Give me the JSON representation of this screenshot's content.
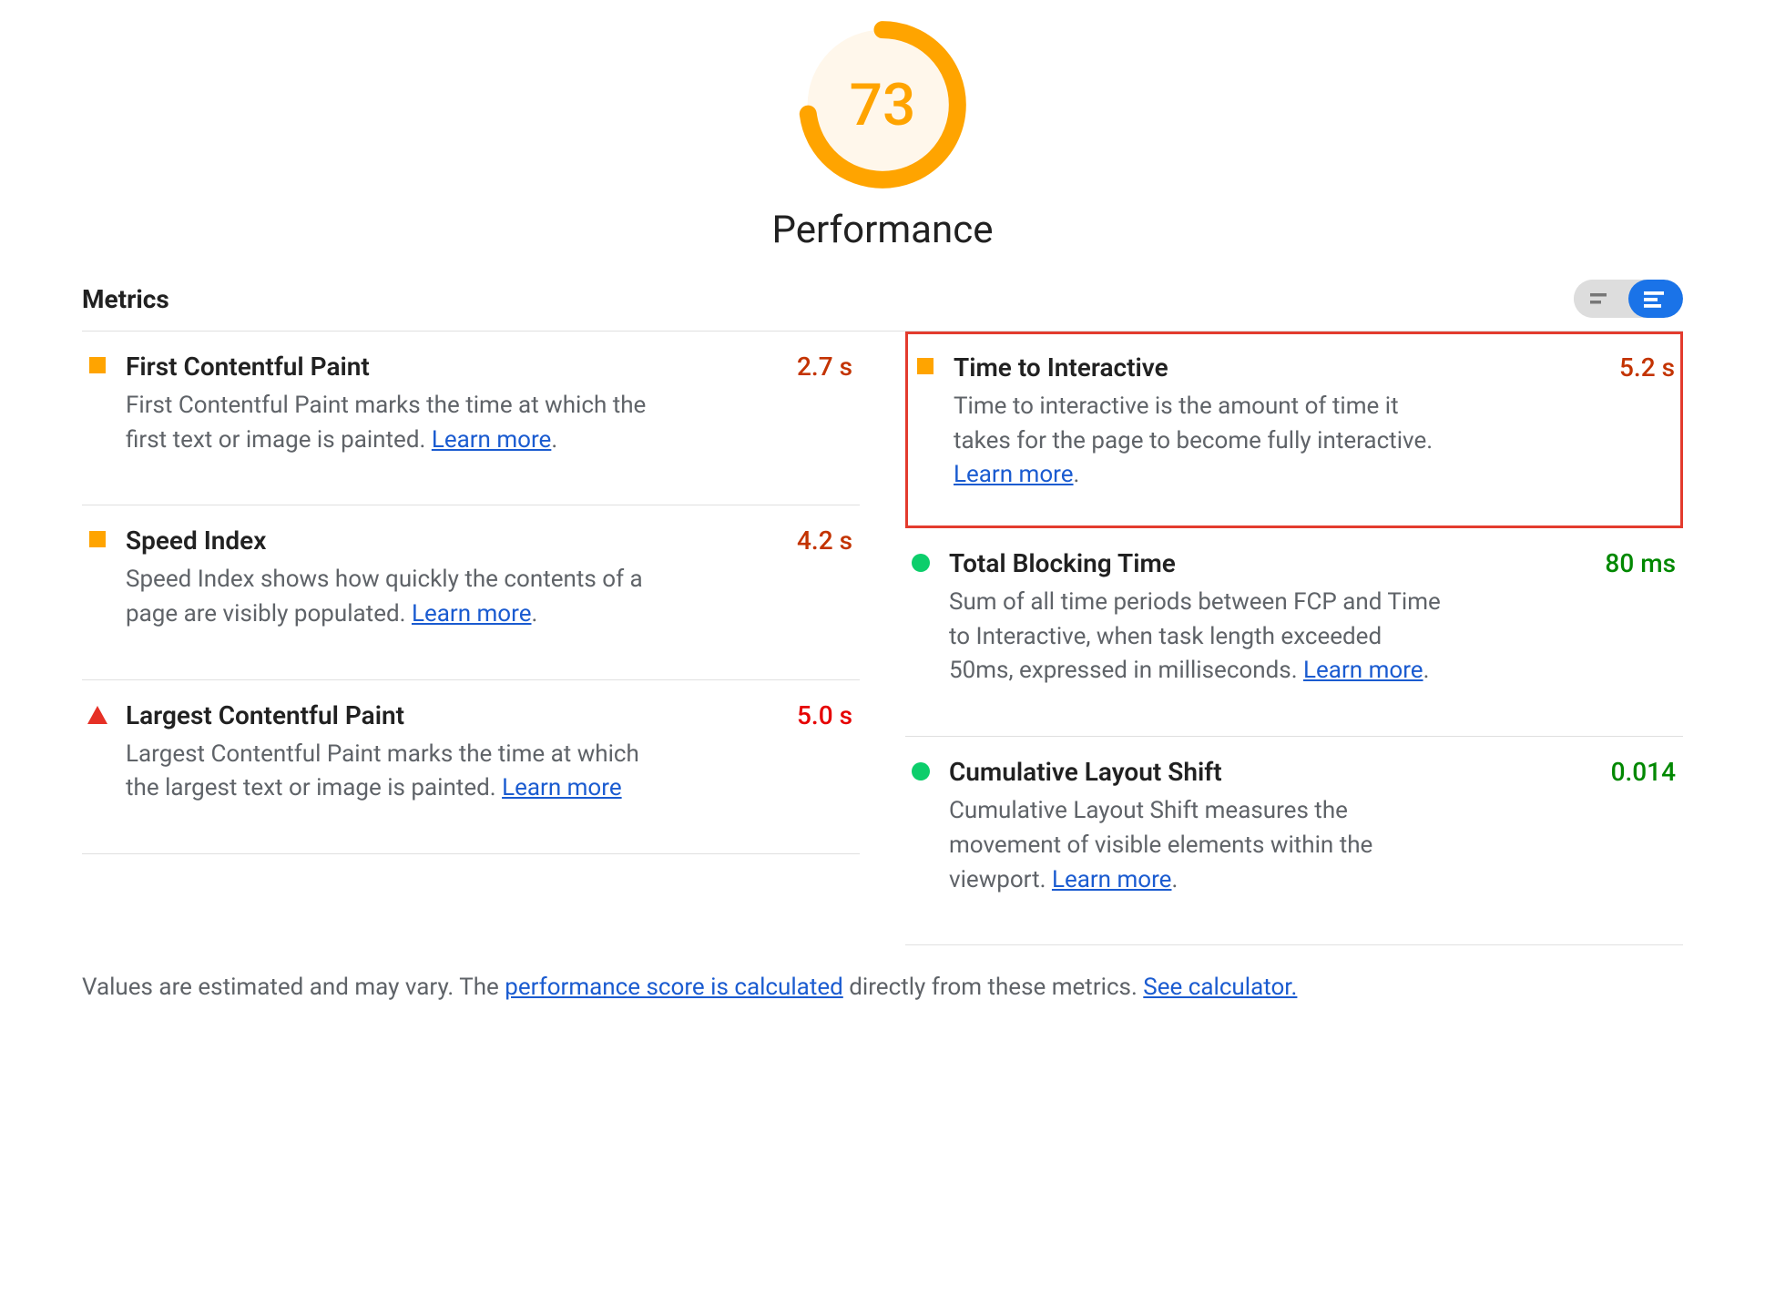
{
  "score": "73",
  "title": "Performance",
  "metrics_heading": "Metrics",
  "learn_more": "Learn more",
  "metrics": {
    "fcp": {
      "name": "First Contentful Paint",
      "value": "2.7 s",
      "desc": "First Contentful Paint marks the time at which the first text or image is painted."
    },
    "si": {
      "name": "Speed Index",
      "value": "4.2 s",
      "desc": "Speed Index shows how quickly the contents of a page are visibly populated."
    },
    "lcp": {
      "name": "Largest Contentful Paint",
      "value": "5.0 s",
      "desc": "Largest Contentful Paint marks the time at which the largest text or image is painted."
    },
    "tti": {
      "name": "Time to Interactive",
      "value": "5.2 s",
      "desc": "Time to interactive is the amount of time it takes for the page to become fully interactive."
    },
    "tbt": {
      "name": "Total Blocking Time",
      "value": "80 ms",
      "desc": "Sum of all time periods between FCP and Time to Interactive, when task length exceeded 50ms, expressed in milliseconds."
    },
    "cls": {
      "name": "Cumulative Layout Shift",
      "value": "0.014",
      "desc": "Cumulative Layout Shift measures the movement of visible elements within the viewport."
    }
  },
  "footer": {
    "pre": "Values are estimated and may vary. The ",
    "link1": "performance score is calculated",
    "mid": " directly from these metrics. ",
    "link2": "See calculator."
  }
}
